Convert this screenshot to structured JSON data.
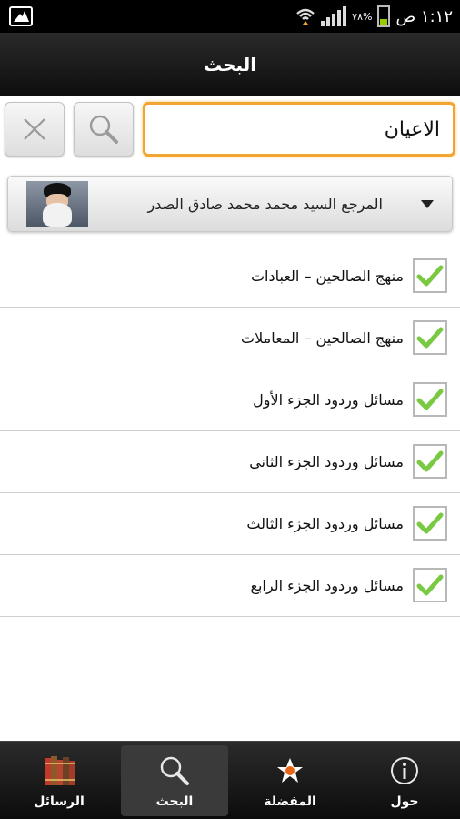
{
  "status_bar": {
    "time": "١:١٢ ص",
    "battery": "٧٨%"
  },
  "header": {
    "title": "البحث"
  },
  "search": {
    "value": "الاعيان",
    "search_icon": "magnifier-icon",
    "clear_icon": "close-x-icon"
  },
  "reference": {
    "name": "المرجع السيد محمد محمد صادق الصدر"
  },
  "books": [
    {
      "label": "منهج الصالحين – العبادات",
      "checked": true
    },
    {
      "label": "منهج الصالحين – المعاملات",
      "checked": true
    },
    {
      "label": "مسائل وردود  الجزء الأول",
      "checked": true
    },
    {
      "label": "مسائل وردود  الجزء الثاني",
      "checked": true
    },
    {
      "label": "مسائل وردود  الجزء الثالث",
      "checked": true
    },
    {
      "label": "مسائل وردود   الجزء الرابع",
      "checked": true
    }
  ],
  "bottom_nav": {
    "items": [
      {
        "label": "الرسائل",
        "icon": "books-icon"
      },
      {
        "label": "البحث",
        "icon": "search-icon",
        "active": true
      },
      {
        "label": "المفضلة",
        "icon": "star-icon"
      },
      {
        "label": "حول",
        "icon": "info-icon"
      }
    ]
  },
  "colors": {
    "accent": "#f2a531",
    "check": "#7ac943",
    "star": "#e8651a"
  }
}
